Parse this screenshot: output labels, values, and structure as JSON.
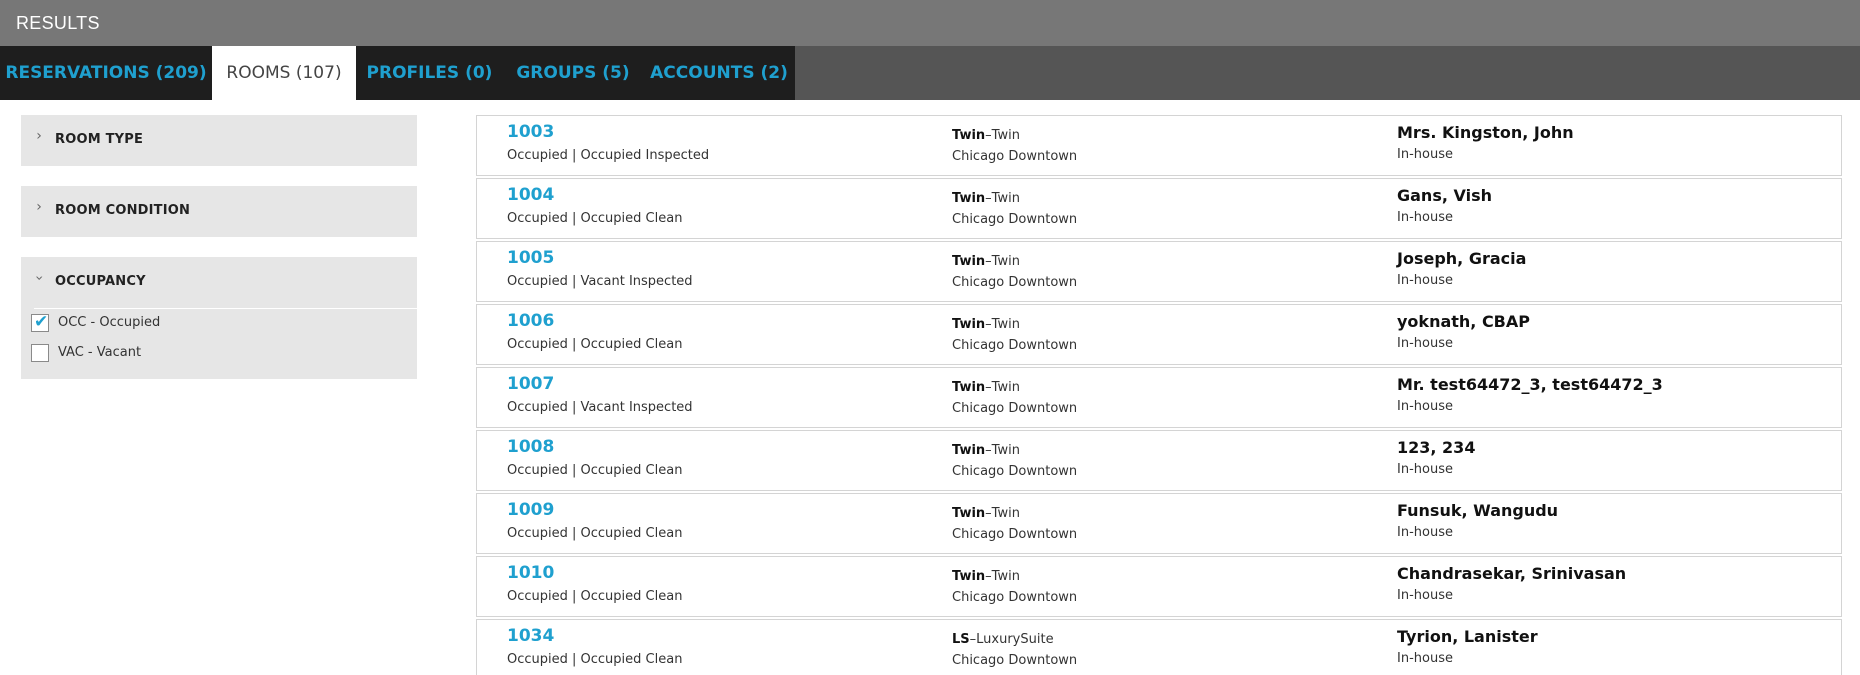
{
  "header": {
    "title": "RESULTS"
  },
  "tabs": [
    {
      "label": "RESERVATIONS (209)",
      "active": false
    },
    {
      "label": "ROOMS (107)",
      "active": true
    },
    {
      "label": "PROFILES (0)",
      "active": false
    },
    {
      "label": "GROUPS (5)",
      "active": false
    },
    {
      "label": "ACCOUNTS (2)",
      "active": false
    }
  ],
  "filters": {
    "room_type": {
      "title": "ROOM TYPE",
      "expanded": false,
      "icon": "chevron-right-icon"
    },
    "room_condition": {
      "title": "ROOM CONDITION",
      "expanded": false,
      "icon": "chevron-right-icon"
    },
    "occupancy": {
      "title": "OCCUPANCY",
      "expanded": true,
      "icon": "chevron-down-icon",
      "options": [
        {
          "label": "OCC - Occupied",
          "checked": true
        },
        {
          "label": "VAC - Vacant",
          "checked": false
        }
      ]
    }
  },
  "rooms": [
    {
      "number": "1003",
      "status": "Occupied | Occupied Inspected",
      "type_code": "Twin",
      "type_name": "Twin",
      "location": "Chicago Downtown",
      "guest": "Mrs. Kingston, John",
      "guest_status": "In-house"
    },
    {
      "number": "1004",
      "status": "Occupied | Occupied Clean",
      "type_code": "Twin",
      "type_name": "Twin",
      "location": "Chicago Downtown",
      "guest": "Gans, Vish",
      "guest_status": "In-house"
    },
    {
      "number": "1005",
      "status": "Occupied | Vacant Inspected",
      "type_code": "Twin",
      "type_name": "Twin",
      "location": "Chicago Downtown",
      "guest": "Joseph, Gracia",
      "guest_status": "In-house"
    },
    {
      "number": "1006",
      "status": "Occupied | Occupied Clean",
      "type_code": "Twin",
      "type_name": "Twin",
      "location": "Chicago Downtown",
      "guest": "yoknath, CBAP",
      "guest_status": "In-house"
    },
    {
      "number": "1007",
      "status": "Occupied | Vacant Inspected",
      "type_code": "Twin",
      "type_name": "Twin",
      "location": "Chicago Downtown",
      "guest": "Mr. test64472_3, test64472_3",
      "guest_status": "In-house"
    },
    {
      "number": "1008",
      "status": "Occupied | Occupied Clean",
      "type_code": "Twin",
      "type_name": "Twin",
      "location": "Chicago Downtown",
      "guest": "123, 234",
      "guest_status": "In-house"
    },
    {
      "number": "1009",
      "status": "Occupied | Occupied Clean",
      "type_code": "Twin",
      "type_name": "Twin",
      "location": "Chicago Downtown",
      "guest": "Funsuk, Wangudu",
      "guest_status": "In-house"
    },
    {
      "number": "1010",
      "status": "Occupied | Occupied Clean",
      "type_code": "Twin",
      "type_name": "Twin",
      "location": "Chicago Downtown",
      "guest": "Chandrasekar, Srinivasan",
      "guest_status": "In-house"
    },
    {
      "number": "1034",
      "status": "Occupied | Occupied Clean",
      "type_code": "LS",
      "type_name": "LuxurySuite",
      "location": "Chicago Downtown",
      "guest": "Tyrion, Lanister",
      "guest_status": "In-house"
    }
  ],
  "colors": {
    "accent": "#1fa0cf",
    "titlebar": "#777777",
    "tabbar": "#1e1e1e",
    "panel": "#e6e6e6"
  }
}
